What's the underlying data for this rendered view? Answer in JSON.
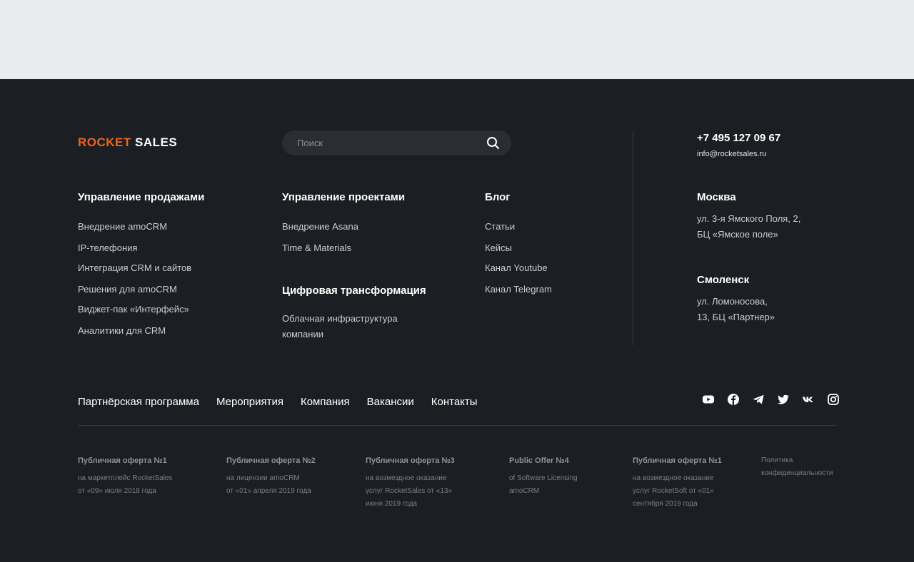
{
  "brand": {
    "logo_accent": "ROCKET",
    "logo_rest": "SALES",
    "accent_color": "#f0621e"
  },
  "search": {
    "placeholder": "Поиск",
    "icon": "search-icon"
  },
  "columns": {
    "sales": {
      "title": "Управление продажами",
      "items": [
        "Внедрение amoCRM",
        "IP-телефония",
        "Интеграция CRM и сайтов",
        "Решения для amoCRM",
        "Виджет-пак «Интерфейс»",
        "Аналитики для CRM"
      ]
    },
    "projects": {
      "title": "Управление проектами",
      "items": [
        "Внедрение Asana",
        "Time & Materials"
      ]
    },
    "digital": {
      "title": "Цифровая трансформация",
      "item_line1": "Облачная инфраструктура",
      "item_line2": "компании"
    },
    "blog": {
      "title": "Блог",
      "items": [
        "Статьи",
        "Кейсы",
        "Канал Youtube",
        "Канал Telegram"
      ]
    }
  },
  "contacts": {
    "phone": "+7 495 127 09 67",
    "email": "info@rocketsales.ru",
    "moscow": {
      "title": "Москва",
      "line1": "ул. 3-я Ямского Поля, 2,",
      "line2": "БЦ «Ямское поле»"
    },
    "smolensk": {
      "title": "Смоленск",
      "line1": "ул. Ломоносова,",
      "line2": "13, БЦ «Партнер»"
    }
  },
  "nav": [
    "Партнёрская программа",
    "Мероприятия",
    "Компания",
    "Вакансии",
    "Контакты"
  ],
  "socials": [
    "youtube-icon",
    "facebook-icon",
    "telegram-icon",
    "twitter-icon",
    "vk-icon",
    "instagram-icon"
  ],
  "offers": [
    {
      "title": "Публичная оферта №1",
      "line1": "на маркетплейс RocketSales",
      "line2": "от «09» июля 2018 года"
    },
    {
      "title": "Публичная оферта №2",
      "line1": "на лицензии amoCRM",
      "line2": "от «01» апреля 2019 года"
    },
    {
      "title": "Публичная оферта №3",
      "line1": "на возмездное оказание",
      "line2": "услуг RocketSales от «13»",
      "line3": "июня 2019 года"
    },
    {
      "title": "Public Offer №4",
      "line1": "of Software Licensing",
      "line2": "amoCRM"
    },
    {
      "title": "Публичная оферта №1",
      "line1": "на возмездное оказание",
      "line2": "услуг RocketSoft от «01»",
      "line3": "сентября 2019 года"
    }
  ],
  "privacy": {
    "line1": "Политика",
    "line2": "конфиденциальности"
  }
}
